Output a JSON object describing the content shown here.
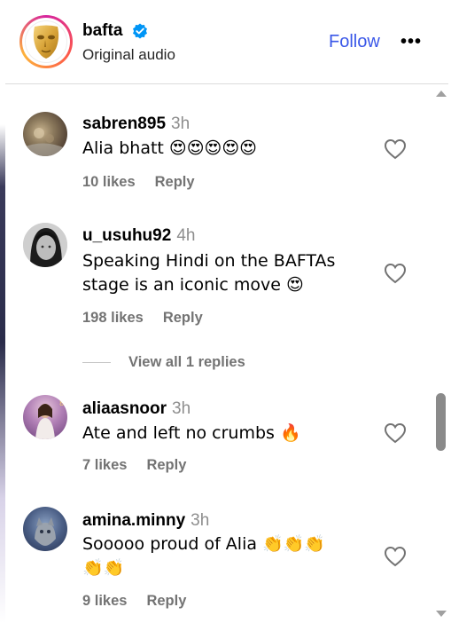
{
  "header": {
    "account_name": "bafta",
    "subtitle": "Original audio",
    "follow_label": "Follow",
    "more_label": "•••",
    "verified": true,
    "ring_colors": [
      "#d6249f",
      "#fd5949",
      "#fdb33b"
    ]
  },
  "comments": [
    {
      "username": "sabren895",
      "time": "3h",
      "text": "Alia bhatt 😍😍😍😍😍",
      "likes": "10 likes",
      "reply_label": "Reply"
    },
    {
      "username": "u_usuhu92",
      "time": "4h",
      "text": "Speaking Hindi on the BAFTAs stage is an iconic move 😍",
      "likes": "198 likes",
      "reply_label": "Reply"
    },
    {
      "username": "aliaasnoor",
      "time": "3h",
      "text": "Ate and left no crumbs 🔥",
      "likes": "7 likes",
      "reply_label": "Reply"
    },
    {
      "username": "amina.minny",
      "time": "3h",
      "text": "Sooooo proud of Alia 👏👏👏👏👏",
      "likes": "9 likes",
      "reply_label": "Reply"
    }
  ],
  "view_replies_label": "View all 1 replies",
  "colors": {
    "follow": "#3a57e8",
    "muted": "#737373",
    "verified": "#0095f6"
  }
}
